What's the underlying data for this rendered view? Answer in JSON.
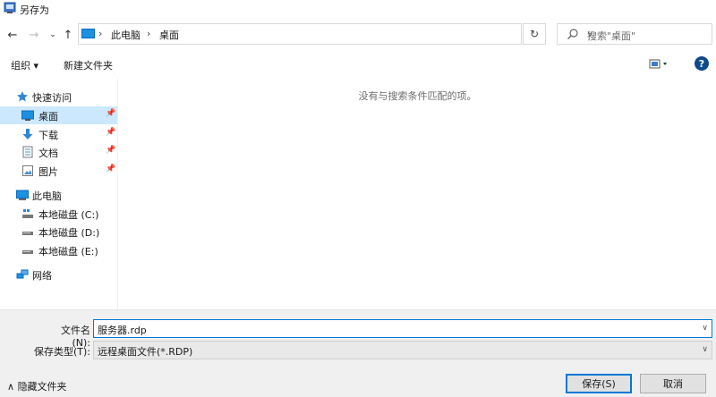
{
  "window": {
    "title": "另存为"
  },
  "nav": {
    "breadcrumb": [
      "此电脑",
      "桌面"
    ],
    "separator": "›",
    "search_placeholder": "搜索\"桌面\""
  },
  "toolbar": {
    "organize": "组织 ▾",
    "new_folder": "新建文件夹"
  },
  "sidebar": {
    "quick_access": "快速访问",
    "items": [
      {
        "label": "桌面",
        "pinned": true
      },
      {
        "label": "下载",
        "pinned": true
      },
      {
        "label": "文档",
        "pinned": true
      },
      {
        "label": "图片",
        "pinned": true
      }
    ],
    "this_pc": "此电脑",
    "drives": [
      "本地磁盘 (C:)",
      "本地磁盘 (D:)",
      "本地磁盘 (E:)"
    ],
    "network": "网络"
  },
  "content": {
    "empty_message": "没有与搜索条件匹配的项。"
  },
  "form": {
    "filename_label": "文件名(N):",
    "filename_value": "服务器.rdp",
    "filetype_label": "保存类型(T):",
    "filetype_value": "远程桌面文件(*.RDP)"
  },
  "footer": {
    "hide_folders": "隐藏文件夹",
    "save": "保存(S)",
    "cancel": "取消"
  },
  "colors": {
    "accent": "#0078d7",
    "selected_bg": "#cce8ff",
    "bottom_bg": "#f0f0f0"
  }
}
